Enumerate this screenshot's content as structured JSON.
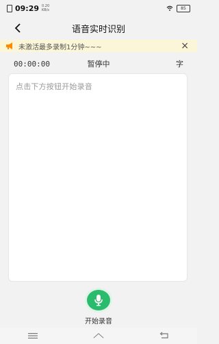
{
  "status": {
    "time": "09:29",
    "speed_value": "0.20",
    "speed_unit": "KB/s",
    "battery": "85"
  },
  "nav": {
    "title": "语音实时识别"
  },
  "notice": {
    "text": "未激活最多录制1分钟~~~",
    "close": "×"
  },
  "toolbar": {
    "timer": "00:00:00",
    "state": "暂停中",
    "font_button": "字"
  },
  "text_area": {
    "placeholder": "点击下方按钮开始录音"
  },
  "record": {
    "label": "开始录音"
  },
  "colors": {
    "accent": "#2bbb6c",
    "notice_bg": "#fbf6d8",
    "notice_icon": "#ff8a00"
  }
}
